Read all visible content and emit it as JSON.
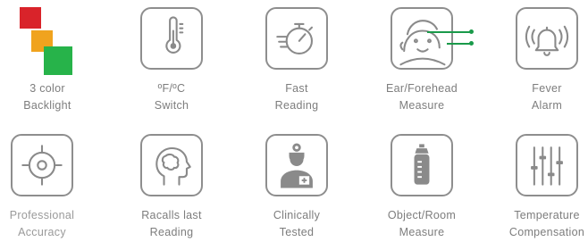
{
  "features": [
    {
      "icon": "color-squares-icon",
      "line1": "3 color",
      "line2": "Backlight"
    },
    {
      "icon": "thermometer-icon",
      "line1": "ºF/ºC",
      "line2": "Switch"
    },
    {
      "icon": "stopwatch-icon",
      "line1": "Fast",
      "line2": "Reading"
    },
    {
      "icon": "child-face-icon",
      "line1": "Ear/Forehead",
      "line2": "Measure"
    },
    {
      "icon": "alarm-bell-icon",
      "line1": "Fever",
      "line2": "Alarm"
    },
    {
      "icon": "crosshair-icon",
      "line1": "Professional",
      "line2": "Accuracy"
    },
    {
      "icon": "head-brain-icon",
      "line1": "Racalls last",
      "line2": "Reading"
    },
    {
      "icon": "doctor-icon",
      "line1": "Clinically",
      "line2": "Tested"
    },
    {
      "icon": "baby-bottle-icon",
      "line1": "Object/Room",
      "line2": "Measure"
    },
    {
      "icon": "sliders-icon",
      "line1": "Temperature",
      "line2": "Compensation"
    }
  ],
  "colors": {
    "tile_border": "#8e8e8e",
    "label": "#7d7d7d",
    "backlight_red": "#d9232a",
    "backlight_orange": "#f0a31e",
    "backlight_green": "#27b34a",
    "indicator_green": "#1a9a4a"
  }
}
